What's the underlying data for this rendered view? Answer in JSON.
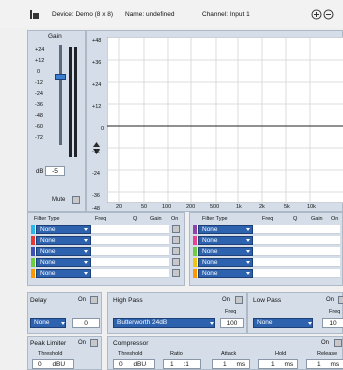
{
  "header": {
    "device": "Device: Demo (8 x 8)",
    "name": "Name: undefined",
    "channel": "Channel: Input 1",
    "icons": [
      "logo-icon",
      "add-circle-icon",
      "remove-circle-icon"
    ]
  },
  "gain": {
    "title": "Gain",
    "scale": [
      "+24",
      "+12",
      "0",
      "-12",
      "-24",
      "-36",
      "-48",
      "-60",
      "-72"
    ],
    "unit": "dB",
    "value": "-5",
    "mute_label": "Mute"
  },
  "graph": {
    "y_ticks": [
      "+48",
      "+36",
      "+24",
      "+12",
      "0",
      "-12",
      "-24",
      "-36",
      "-48"
    ],
    "x_ticks": [
      "20",
      "50",
      "100",
      "200",
      "500",
      "1k",
      "2k",
      "5k",
      "10k"
    ]
  },
  "filters_left": {
    "headers": {
      "type": "Filter Type",
      "freq": "Freq",
      "q": "Q",
      "gain": "Gain",
      "on": "On"
    },
    "rows": [
      {
        "type": "None",
        "color": "#29b6e8"
      },
      {
        "type": "None",
        "color": "#e53935"
      },
      {
        "type": "None",
        "color": "#3f51b5"
      },
      {
        "type": "None",
        "color": "#6dcf3f"
      },
      {
        "type": "None",
        "color": "#ff9800"
      }
    ]
  },
  "filters_right": {
    "headers": {
      "type": "Filter Type",
      "freq": "Freq",
      "q": "Q",
      "gain": "Gain",
      "on": "On"
    },
    "rows": [
      {
        "type": "None",
        "color": "#8e44ad"
      },
      {
        "type": "None",
        "color": "#e84393"
      },
      {
        "type": "None",
        "color": "#6dcf3f"
      },
      {
        "type": "None",
        "color": "#f1c40f"
      },
      {
        "type": "None",
        "color": "#ff9800"
      }
    ]
  },
  "delay": {
    "title": "Delay",
    "on": "On",
    "select": "None",
    "value": "0"
  },
  "high_pass": {
    "title": "High Pass",
    "on": "On",
    "select": "Butterworth 24dB",
    "freq_label": "Freq",
    "freq": "100"
  },
  "low_pass": {
    "title": "Low Pass",
    "on": "On",
    "select": "None",
    "freq_label": "Freq",
    "freq": "10"
  },
  "peak_limiter": {
    "title": "Peak Limiter",
    "on": "On",
    "threshold_label": "Threshold",
    "threshold_value": "0",
    "threshold_unit": "dBU"
  },
  "compressor": {
    "title": "Compressor",
    "on": "On",
    "threshold_label": "Threshold",
    "threshold_value": "0",
    "threshold_unit": "dBU",
    "ratio_label": "Ratio",
    "ratio_value": "1",
    "ratio_unit": ":1",
    "attack_label": "Attack",
    "attack_value": "1",
    "attack_unit": "ms",
    "hold_label": "Hold",
    "hold_value": "1",
    "hold_unit": "ms",
    "release_label": "Release",
    "release_value": "1",
    "release_unit": "ms"
  },
  "colors": {
    "accent": "#2d62ae",
    "panel": "#d4dde8"
  }
}
